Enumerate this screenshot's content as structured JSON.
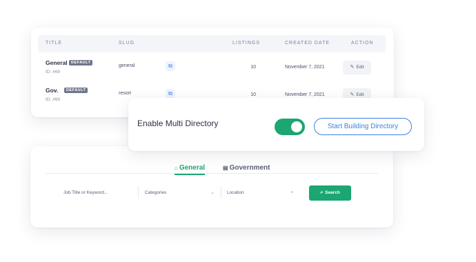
{
  "table": {
    "headers": {
      "title": "TITLE",
      "slug": "SLUG",
      "listings": "LISTINGS",
      "created": "CREATED DATE",
      "action": "ACTION"
    },
    "rows": [
      {
        "name": "General",
        "badge": "DEFAULT",
        "id": "ID: #69",
        "slug": "general",
        "listings": "10",
        "date": "November 7, 2021",
        "action": "Edit"
      },
      {
        "name": "Gov.",
        "badge": "DEFAULT",
        "id": "ID: #69",
        "slug": "resort",
        "listings": "10",
        "date": "November 7, 2021",
        "action": "Edit"
      }
    ],
    "icons": {
      "copy": "copy-icon",
      "edit": "edit-icon"
    }
  },
  "multi_directory": {
    "label": "Enable Multi Directory",
    "enabled": true,
    "button": "Start Building Directory"
  },
  "search": {
    "tabs": [
      {
        "label": "General",
        "icon": "home-icon",
        "active": true
      },
      {
        "label": "Government",
        "icon": "building-icon",
        "active": false
      }
    ],
    "keyword_placeholder": "Job Title or Keyword...",
    "category_value": "Categories",
    "location_placeholder": "Location",
    "button": "Search"
  },
  "colors": {
    "accent_green": "#1ba672",
    "accent_blue": "#3e7fe0",
    "badge_gray": "#70768c"
  }
}
